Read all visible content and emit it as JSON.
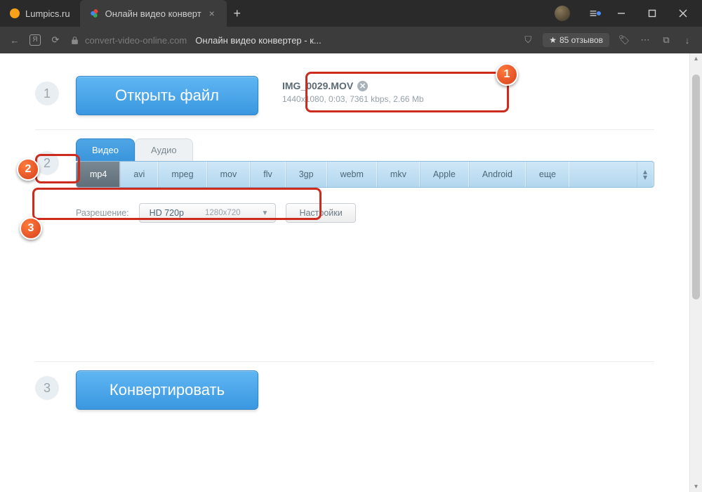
{
  "browser": {
    "tabs": [
      {
        "title": "Lumpics.ru"
      },
      {
        "title": "Онлайн видео конверт"
      }
    ],
    "url_domain": "convert-video-online.com",
    "url_title": "Онлайн видео конвертер - к...",
    "reviews": "85 отзывов"
  },
  "step1": {
    "num": "1",
    "open_btn": "Открыть файл",
    "file_name": "IMG_0029.MOV",
    "file_meta": "1440x1080, 0:03, 7361 kbps, 2.66 Mb"
  },
  "step2": {
    "num": "2",
    "tab_video": "Видео",
    "tab_audio": "Аудио",
    "formats": [
      "mp4",
      "avi",
      "mpeg",
      "mov",
      "flv",
      "3gp",
      "webm",
      "mkv",
      "Apple",
      "Android",
      "еще"
    ],
    "res_label": "Разрешение:",
    "res_name": "HD 720p",
    "res_dim": "1280x720",
    "settings": "Настройки"
  },
  "step3": {
    "num": "3",
    "convert_btn": "Конвертировать"
  },
  "badges": {
    "b1": "1",
    "b2": "2",
    "b3": "3"
  }
}
